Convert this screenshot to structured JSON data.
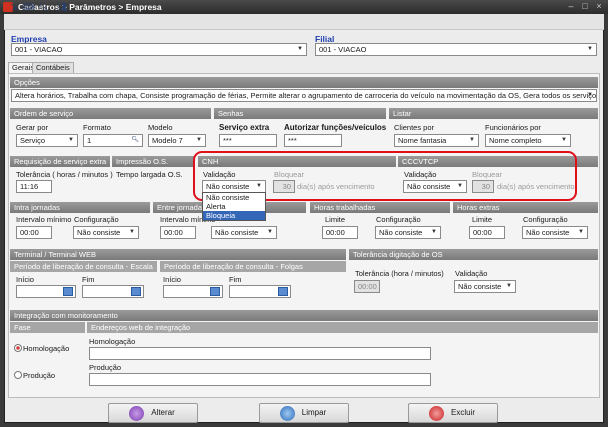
{
  "window": {
    "title": "Cadastros > Parâmetros > Empresa"
  },
  "toolbar": {
    "icons": [
      "save-exit-icon",
      "keyboard-icon",
      "search-icon",
      "users-icon"
    ]
  },
  "empresa": {
    "label": "Empresa",
    "value": "001 - VIACAO"
  },
  "filial": {
    "label": "Filial",
    "value": "001 - VIACAO"
  },
  "tabs": {
    "gerais": "Gerais",
    "contabeis": "Contábeis"
  },
  "opcoes": {
    "title": "Opções",
    "value": "Altera horários, Trabalha com chapa, Consiste programação de férias, Permite alterar o agrupamento de carroceria do veículo na movimentação da OS, Gera todos os serviços como extra na ..."
  },
  "ordem": {
    "title": "Ordem de serviço",
    "gerar_label": "Gerar por",
    "gerar_value": "Serviço",
    "formato_label": "Formato",
    "formato_value": "1",
    "modelo_label": "Modelo",
    "modelo_value": "Modelo 7"
  },
  "senhas": {
    "title": "Senhas",
    "servico_label": "Serviço extra",
    "servico_value": "***",
    "autorizar_label": "Autorizar funções/veículos",
    "autorizar_value": "***"
  },
  "listar": {
    "title": "Listar",
    "clientes_label": "Clientes por",
    "clientes_value": "Nome fantasia",
    "funcionarios_label": "Funcionários por",
    "funcionarios_value": "Nome completo"
  },
  "requisicao": {
    "title": "Requisição de serviço extra",
    "tol_label": "Tolerância ( horas / minutos )",
    "tol_value": "11:16"
  },
  "impressao": {
    "title": "Impressão O.S.",
    "tempo_label": "Tempo largada O.S."
  },
  "cnh": {
    "title": "CNH",
    "validacao_label": "Validação",
    "validacao_value": "Não consiste",
    "bloquear_label": "Bloquear",
    "bloquear_value": "30",
    "dias_label": "dia(s) após vencimento",
    "options": [
      "Não consiste",
      "Alerta",
      "Bloqueia"
    ]
  },
  "cccvtcp": {
    "title": "CCCVTCP",
    "validacao_label": "Validação",
    "validacao_value": "Não consiste",
    "bloquear_label": "Bloquear",
    "bloquear_value": "30",
    "dias_label": "dia(s) após vencimento"
  },
  "intra": {
    "title": "Intra jornadas",
    "intervalo_label": "Intervalo mínimo",
    "intervalo_value": "00:00",
    "config_label": "Configuração",
    "config_value": "Não consiste"
  },
  "entre": {
    "title": "Entre jornadas",
    "intervalo_label": "Intervalo mínimo",
    "intervalo_value": "00:00",
    "config_value": "Não consiste"
  },
  "horas_trab": {
    "title": "Horas trabalhadas",
    "limite_label": "Limite",
    "limite_value": "00:00",
    "config_label": "Configuração",
    "config_value": "Não consiste"
  },
  "horas_extras": {
    "title": "Horas extras",
    "limite_label": "Limite",
    "limite_value": "00:00",
    "config_label": "Configuração",
    "config_value": "Não consiste"
  },
  "terminal": {
    "title": "Terminal / Terminal WEB",
    "escala_title": "Período de liberação de consulta - Escala",
    "folgas_title": "Período de liberação de consulta - Folgas",
    "inicio_label": "Início",
    "fim_label": "Fim"
  },
  "tol_os": {
    "title": "Tolerância digitação de OS",
    "tol_label": "Tolerância (hora / minutos)",
    "tol_value": "00:00",
    "validacao_label": "Validação",
    "validacao_value": "Não consiste"
  },
  "integracao": {
    "title": "Integração com monitoramento",
    "fase_label": "Fase",
    "enderecos_label": "Endereços web de integração",
    "homologacao": "Homologação",
    "producao": "Produção"
  },
  "buttons": {
    "alterar": "Alterar",
    "limpar": "Limpar",
    "excluir": "Excluir"
  },
  "colors": {
    "highlight": "#e0101a",
    "label_blue": "#1f3fb0",
    "group_bar": "#8a8a8a"
  }
}
